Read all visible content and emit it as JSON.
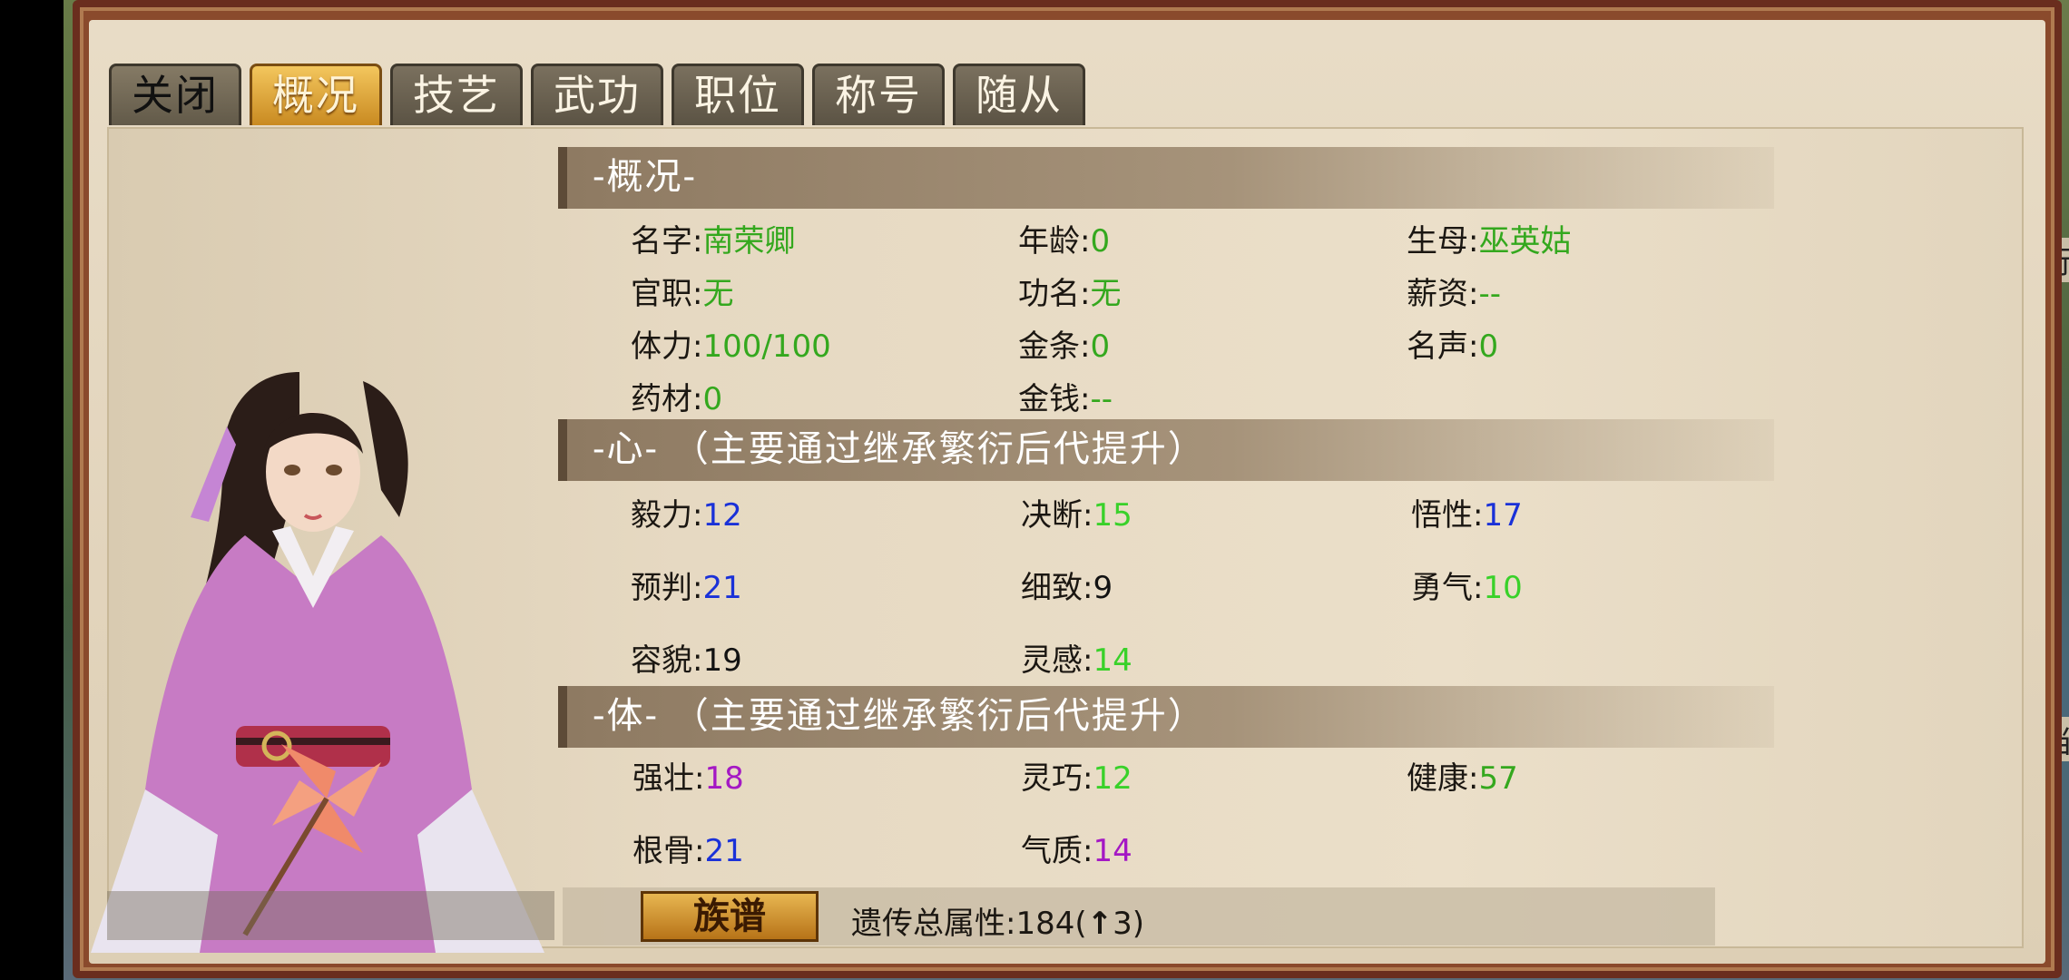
{
  "tabs": [
    "关闭",
    "概况",
    "技艺",
    "武功",
    "职位",
    "称号",
    "随从"
  ],
  "active_tab": "概况",
  "sections": {
    "overview_title": "-概况-",
    "heart_title": "-心- （主要通过继承繁衍后代提升）",
    "body_title": "-体- （主要通过继承繁衍后代提升）"
  },
  "overview": [
    {
      "label": "名字:",
      "value": "南荣卿"
    },
    {
      "label": "年龄:",
      "value": "0"
    },
    {
      "label": "生母:",
      "value": "巫英姑"
    },
    {
      "label": "官职:",
      "value": "无"
    },
    {
      "label": "功名:",
      "value": "无"
    },
    {
      "label": "薪资:",
      "value": "--"
    },
    {
      "label": "体力:",
      "value": "100/100"
    },
    {
      "label": "金条:",
      "value": "0"
    },
    {
      "label": "名声:",
      "value": "0"
    },
    {
      "label": "药材:",
      "value": "0"
    },
    {
      "label": "金钱:",
      "value": "--"
    }
  ],
  "heart": [
    {
      "label": "毅力:",
      "value": "12"
    },
    {
      "label": "决断:",
      "value": "15"
    },
    {
      "label": "悟性:",
      "value": "17"
    },
    {
      "label": "预判:",
      "value": "21"
    },
    {
      "label": "细致:",
      "value": "9"
    },
    {
      "label": "勇气:",
      "value": "10"
    },
    {
      "label": "容貌:",
      "value": "19"
    },
    {
      "label": "灵感:",
      "value": "14"
    }
  ],
  "body": [
    {
      "label": "强壮:",
      "value": "18"
    },
    {
      "label": "灵巧:",
      "value": "12"
    },
    {
      "label": "健康:",
      "value": "57"
    },
    {
      "label": "根骨:",
      "value": "21"
    },
    {
      "label": "气质:",
      "value": "14"
    }
  ],
  "footer": {
    "genealogy_button": "族谱",
    "heritage_label": "遗传总属性:",
    "heritage_value": "184(",
    "heritage_arrow": "↑",
    "heritage_delta": "3)"
  },
  "edge_chars": [
    "行",
    "当"
  ],
  "colors": {
    "green": "#34a81e",
    "light_green": "#39d12a",
    "blue": "#1a31d8",
    "purple": "#a418c4",
    "tab_active": "#e3a83a"
  }
}
